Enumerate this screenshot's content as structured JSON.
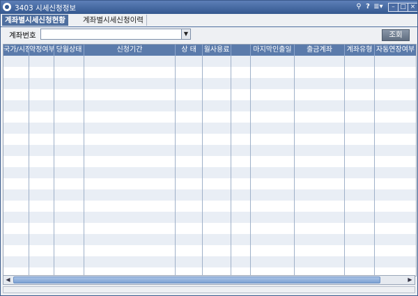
{
  "window": {
    "title": "3403 시세신청정보"
  },
  "titlebar_buttons": {
    "pin": "⚲",
    "help": "?",
    "menu": "≣▾",
    "minimize": "–",
    "maximize": "□",
    "close": "×"
  },
  "tabs": [
    {
      "label": "계좌별시세신청현황",
      "active": true
    },
    {
      "label": "계좌별시세신청이력",
      "active": false
    }
  ],
  "filter": {
    "account_label": "계좌번호",
    "account_value": "",
    "dropdown_glyph": "▼",
    "query_button": "조회"
  },
  "grid": {
    "columns": [
      "국가/시장",
      "약정여부",
      "당월상태",
      "신청기간",
      "상 태",
      "월사용료",
      "",
      "마지막인출일",
      "출금계좌",
      "계좌유형",
      "자동연장여부"
    ],
    "row_count": 20
  },
  "scrollbar": {
    "left_arrow": "◀",
    "right_arrow": "▶"
  },
  "colors": {
    "header_bg": "#5b7bab",
    "alt_row": "#e9eef5",
    "title_bg": "#34588f",
    "active_tab": "#4f6f9f"
  }
}
